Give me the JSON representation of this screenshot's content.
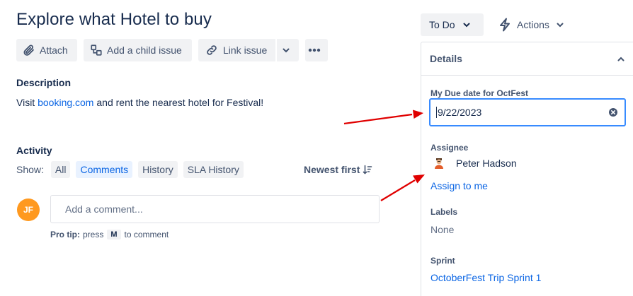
{
  "issue": {
    "title": "Explore what Hotel to buy"
  },
  "toolbar": {
    "attach_label": "Attach",
    "child_label": "Add a child issue",
    "link_label": "Link issue"
  },
  "description": {
    "heading": "Description",
    "text_before": "Visit ",
    "link_text": "booking.com",
    "text_after": " and rent the nearest hotel for Festival!"
  },
  "activity": {
    "heading": "Activity",
    "show_label": "Show:",
    "filters": [
      {
        "label": "All",
        "active": false
      },
      {
        "label": "Comments",
        "active": true
      },
      {
        "label": "History",
        "active": false
      },
      {
        "label": "SLA History",
        "active": false
      }
    ],
    "sort_label": "Newest first"
  },
  "comment": {
    "avatar_initials": "JF",
    "placeholder": "Add a comment...",
    "tip_bold": "Pro tip:",
    "tip_before": "press",
    "tip_key": "M",
    "tip_after": "to comment"
  },
  "header": {
    "status_label": "To Do",
    "actions_label": "Actions"
  },
  "details": {
    "heading": "Details",
    "due_label": "My Due date for OctFest",
    "due_value": "9/22/2023",
    "assignee_label": "Assignee",
    "assignee_name": "Peter Hadson",
    "assign_to_me": "Assign to me",
    "labels_label": "Labels",
    "labels_value": "None",
    "sprint_label": "Sprint",
    "sprint_value": "OctoberFest Trip Sprint 1"
  },
  "colors": {
    "link": "#0c66e4",
    "focus": "#388bff",
    "avatar": "#ff991f",
    "annotation_arrow": "#e00000"
  },
  "icons": [
    "paperclip-icon",
    "child-issue-icon",
    "link-icon",
    "chevron-down-icon",
    "more-icon",
    "sort-icon",
    "lightning-icon",
    "chevron-up-icon",
    "clear-icon",
    "user-avatar-icon"
  ]
}
